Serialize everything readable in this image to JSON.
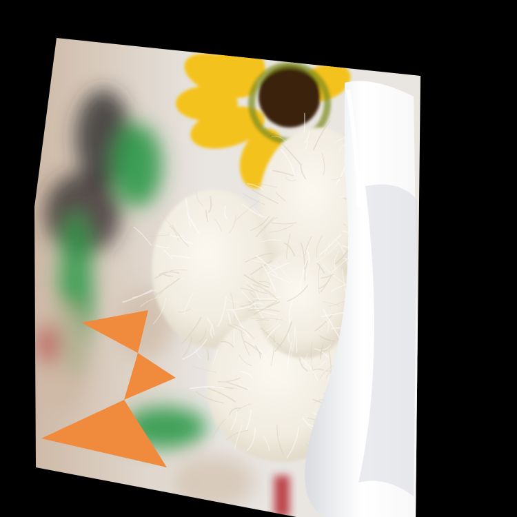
{
  "image": {
    "subject": "photo",
    "colors": {
      "background_frame": "#000000",
      "backdrop_light": "#e9e6e2",
      "backdrop_warm": "#cdb8a4",
      "blur_green": "#2f9a4a",
      "blur_dark": "#2b2a2a",
      "sunflower_petal": "#f4c21a",
      "sunflower_center": "#3a2208",
      "fiber_white": "#f1ece0",
      "fiber_shadow": "#d8d0bd",
      "plate_white": "#f7f7f8",
      "plate_shadow": "#d9dbe0",
      "accent_orange": "#f08a3c",
      "red_accent": "#b4262e"
    },
    "overlay_shape_icon": "orange-bowtie-triangles-icon"
  }
}
